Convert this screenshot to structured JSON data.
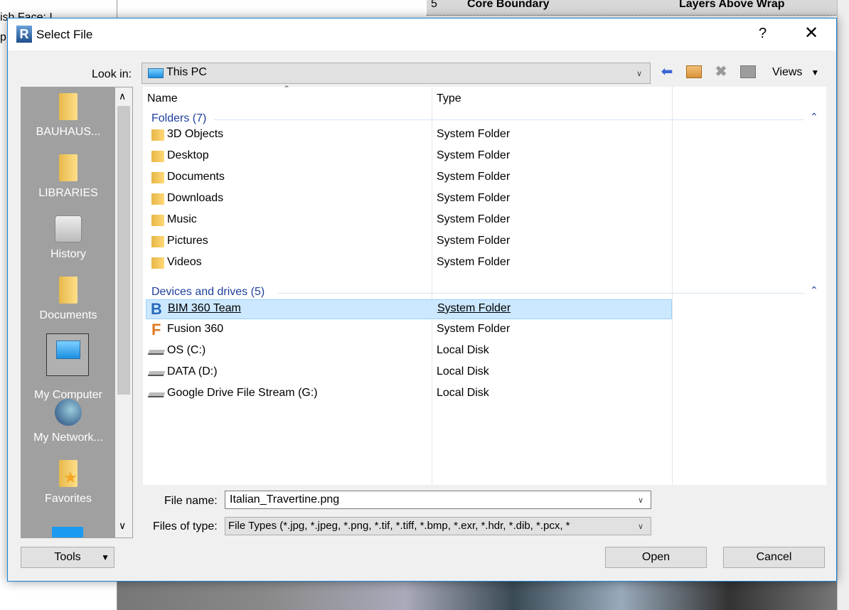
{
  "background": {
    "table": {
      "row_number": "5",
      "col1": "Core Boundary",
      "col2": "Layers Above Wrap"
    },
    "left_fragments": [
      "ish Face: I",
      "p"
    ]
  },
  "dialog": {
    "title": "Select File",
    "help": "?",
    "close": "✕",
    "look_in_label": "Look in:",
    "look_in_value": "This PC",
    "toolbar": {
      "back_icon": "back-arrow-icon",
      "up_folder_icon": "up-folder-icon",
      "delete_icon": "delete-icon",
      "new_folder_icon": "new-folder-icon",
      "views_label": "Views"
    },
    "places": [
      {
        "label": "BAUHAUS...",
        "icon": "folder-icon"
      },
      {
        "label": "LIBRARIES",
        "icon": "folder-icon"
      },
      {
        "label": "History",
        "icon": "history-icon"
      },
      {
        "label": "Documents",
        "icon": "documents-folder-icon"
      },
      {
        "label": "My Computer",
        "icon": "computer-icon",
        "selected": true
      },
      {
        "label": "My Network...",
        "icon": "network-icon"
      },
      {
        "label": "Favorites",
        "icon": "favorites-icon"
      }
    ],
    "columns": {
      "name": "Name",
      "type": "Type"
    },
    "groups": [
      {
        "label": "Folders (7)",
        "items": [
          {
            "name": "3D Objects",
            "type": "System Folder"
          },
          {
            "name": "Desktop",
            "type": "System Folder"
          },
          {
            "name": "Documents",
            "type": "System Folder"
          },
          {
            "name": "Downloads",
            "type": "System Folder"
          },
          {
            "name": "Music",
            "type": "System Folder"
          },
          {
            "name": "Pictures",
            "type": "System Folder"
          },
          {
            "name": "Videos",
            "type": "System Folder"
          }
        ]
      },
      {
        "label": "Devices and drives (5)",
        "items": [
          {
            "name": "BIM 360 Team",
            "type": "System Folder",
            "selected": true
          },
          {
            "name": "Fusion 360",
            "type": "System Folder"
          },
          {
            "name": "OS (C:)",
            "type": "Local Disk"
          },
          {
            "name": "DATA (D:)",
            "type": "Local Disk"
          },
          {
            "name": "Google Drive File Stream (G:)",
            "type": "Local Disk"
          }
        ]
      }
    ],
    "file_name_label": "File name:",
    "file_name_value": "Italian_Travertine.png",
    "file_type_label": "Files of type:",
    "file_type_value": "File Types (*.jpg, *.jpeg, *.png, *.tif, *.tiff, *.bmp, *.exr, *.hdr, *.dib, *.pcx, *",
    "tools_label": "Tools",
    "open_label": "Open",
    "cancel_label": "Cancel",
    "colors": {
      "accent": "#1883d7",
      "group_text": "#1e3f9c",
      "selection": "#cce8ff",
      "places_bg": "#a0a0a0"
    }
  }
}
